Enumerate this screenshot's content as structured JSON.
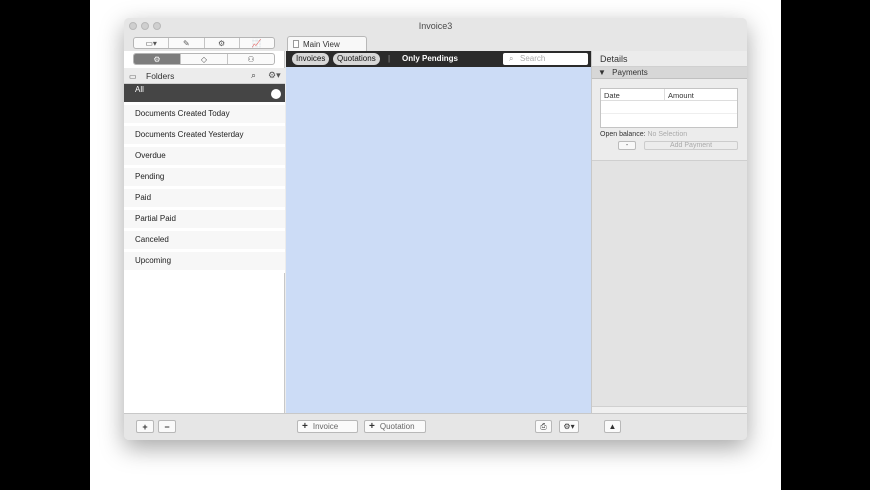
{
  "window": {
    "title": "Invoice3"
  },
  "toolbar": {
    "segments": [
      "▭▾",
      "✎",
      "⚙",
      "📈"
    ],
    "main_tab": "Main View"
  },
  "sidebar": {
    "segments": [
      "⚙",
      "◇",
      "⚇"
    ],
    "header_label": "Folders",
    "folders": [
      {
        "label": "All",
        "selected": true
      },
      {
        "label": "Documents Created Today"
      },
      {
        "label": "Documents Created Yesterday"
      },
      {
        "label": "Overdue"
      },
      {
        "label": "Pending"
      },
      {
        "label": "Paid"
      },
      {
        "label": "Partial Paid"
      },
      {
        "label": "Canceled"
      },
      {
        "label": "Upcoming"
      }
    ]
  },
  "filter_bar": {
    "invoices": "Invoices",
    "quotations": "Quotations",
    "separator": "|",
    "only_pendings": "Only Pendings",
    "search_placeholder": "Search"
  },
  "details": {
    "title": "Details",
    "payments_title": "Payments",
    "columns": [
      "Date",
      "Amount"
    ],
    "open_balance_label": "Open balance:",
    "open_balance_value": "No Selection",
    "minus_label": "-",
    "add_payment_label": "Add Payment"
  },
  "bottom_bar": {
    "add_label": "+",
    "remove_label": "−",
    "new_invoice": "Invoice",
    "new_quotation": "Quotation"
  },
  "colors": {
    "list_background": "#ccdcf6",
    "selected_folder": "#454545"
  }
}
